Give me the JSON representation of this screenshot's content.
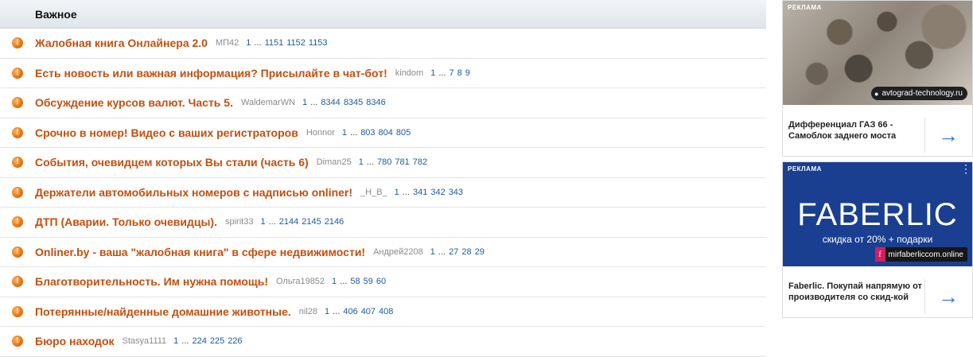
{
  "forum": {
    "section_title": "Важное",
    "topics": [
      {
        "title": "Жалобная книга Онлайнера 2.0",
        "author": "МП42",
        "pages": [
          "1",
          "...",
          "1151",
          "1152",
          "1153"
        ]
      },
      {
        "title": "Есть новость или важная информация? Присылайте в чат-бот!",
        "author": "kindom",
        "pages": [
          "1",
          "...",
          "7",
          "8",
          "9"
        ]
      },
      {
        "title": "Обсуждение курсов валют. Часть 5.",
        "author": "WaldemarWN",
        "pages": [
          "1",
          "...",
          "8344",
          "8345",
          "8346"
        ]
      },
      {
        "title": "Срочно в номер! Видео с ваших регистраторов",
        "author": "Honnor",
        "pages": [
          "1",
          "...",
          "803",
          "804",
          "805"
        ]
      },
      {
        "title": "События, очевидцем которых Вы стали (часть 6)",
        "author": "Diman25",
        "pages": [
          "1",
          "...",
          "780",
          "781",
          "782"
        ]
      },
      {
        "title": "Держатели автомобильных номеров с надписью onliner!",
        "author": "_Н_В_",
        "pages": [
          "1",
          "...",
          "341",
          "342",
          "343"
        ]
      },
      {
        "title": "ДТП (Аварии. Только очевидцы).",
        "author": "spirit33",
        "pages": [
          "1",
          "...",
          "2144",
          "2145",
          "2146"
        ]
      },
      {
        "title": "Onliner.by - ваша \"жалобная книга\" в сфере недвижимости!",
        "author": "Андрей2208",
        "pages": [
          "1",
          "...",
          "27",
          "28",
          "29"
        ]
      },
      {
        "title": "Благотворительность. Им нужна помощь!",
        "author": "Ольга19852",
        "pages": [
          "1",
          "...",
          "58",
          "59",
          "60"
        ]
      },
      {
        "title": "Потерянные/найденные домашние животные.",
        "author": "nil28",
        "pages": [
          "1",
          "...",
          "406",
          "407",
          "408"
        ]
      },
      {
        "title": "Бюро находок",
        "author": "Stasya1111",
        "pages": [
          "1",
          "...",
          "224",
          "225",
          "226"
        ]
      }
    ],
    "marker_glyph": "!"
  },
  "ads": {
    "ad1": {
      "tag": "РЕКЛАМА",
      "domain": "avtograd-technology.ru",
      "text": "Дифференциал ГАЗ 66 - Самоблок заднего моста",
      "arrow": "→"
    },
    "ad2": {
      "tag": "РЕКЛАМА",
      "brand": "FABERLIC",
      "brand_sub": "скидка от 20% + подарки",
      "domain_logo": "f",
      "domain": "mirfaberliccom.online",
      "text": "Faberlic. Покупай напрямую от производителя со скид-кой",
      "more": "⋮",
      "arrow": "→"
    }
  },
  "colors": {
    "topic_title": "#c64e0c",
    "page_link": "#1c5c9c",
    "author": "#8a8a8a",
    "marker": "#e06a05",
    "arrow": "#2c6fd6",
    "faberlic_bg": "#1a3f91"
  }
}
